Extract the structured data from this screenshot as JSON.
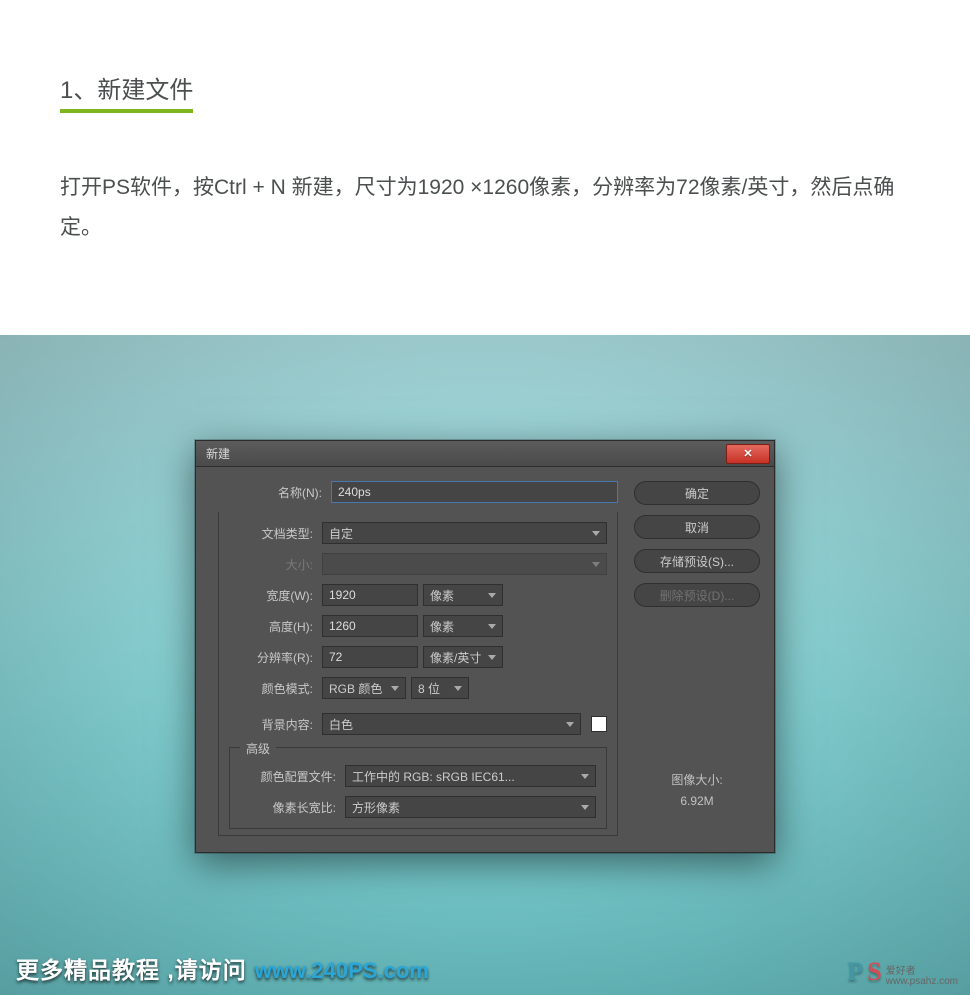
{
  "article": {
    "step_title": "1、新建文件",
    "step_desc": "打开PS软件，按Ctrl + N 新建，尺寸为1920 ×1260像素，分辨率为72像素/英寸，然后点确定。"
  },
  "dialog": {
    "title": "新建",
    "labels": {
      "name": "名称(N):",
      "doctype": "文档类型:",
      "size": "大小:",
      "width": "宽度(W):",
      "height": "高度(H):",
      "resolution": "分辨率(R):",
      "color_mode": "颜色模式:",
      "bg": "背景内容:",
      "advanced": "高级",
      "color_profile": "颜色配置文件:",
      "pixel_aspect": "像素长宽比:"
    },
    "values": {
      "name": "240ps",
      "doctype": "自定",
      "width": "1920",
      "height": "1260",
      "resolution": "72",
      "color_mode": "RGB 颜色",
      "bit_depth": "8 位",
      "bg": "白色",
      "color_profile": "工作中的 RGB: sRGB IEC61...",
      "pixel_aspect": "方形像素"
    },
    "units": {
      "pixels": "像素",
      "ppi": "像素/英寸"
    },
    "buttons": {
      "ok": "确定",
      "cancel": "取消",
      "save_preset": "存储预设(S)...",
      "delete_preset": "删除预设(D)..."
    },
    "image_size_label": "图像大小:",
    "image_size_value": "6.92M"
  },
  "watermark": {
    "text": "更多精品教程 ,请访问",
    "link": "www.240PS.com"
  },
  "pslogo": {
    "p": "P",
    "s": "S",
    "sub1": "爱好者",
    "sub2": "www.psahz.com"
  }
}
